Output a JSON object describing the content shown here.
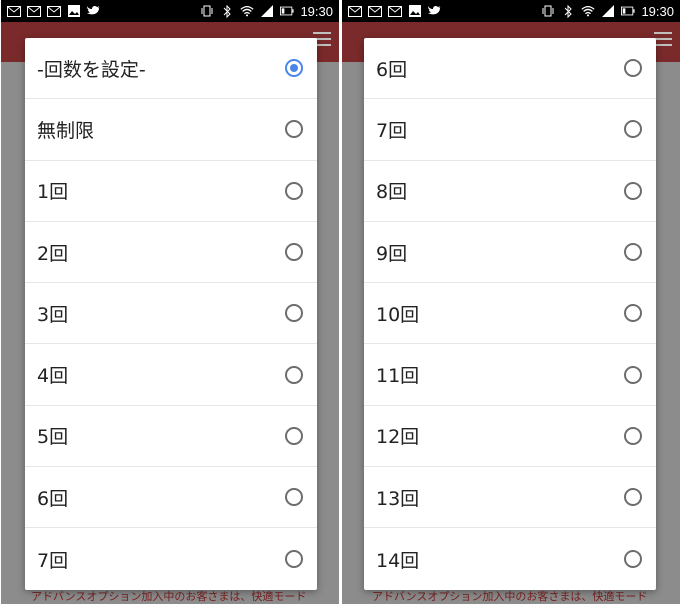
{
  "status_bar": {
    "time": "19:30",
    "icons": [
      "gmail-icon",
      "gmail-icon",
      "gmail-icon",
      "image-icon",
      "twitter-icon",
      "vibrate-icon",
      "bluetooth-icon",
      "wifi-icon",
      "signal-icon",
      "battery-icon"
    ]
  },
  "background": {
    "footer_text": "アドバンスオプション加入中のお客さまは、快適モード"
  },
  "left_dialog": {
    "options": [
      {
        "label": "-回数を設定-",
        "checked": true
      },
      {
        "label": "無制限",
        "checked": false
      },
      {
        "label": "1回",
        "checked": false
      },
      {
        "label": "2回",
        "checked": false
      },
      {
        "label": "3回",
        "checked": false
      },
      {
        "label": "4回",
        "checked": false
      },
      {
        "label": "5回",
        "checked": false
      },
      {
        "label": "6回",
        "checked": false
      },
      {
        "label": "7回",
        "checked": false
      }
    ]
  },
  "right_dialog": {
    "options": [
      {
        "label": "6回",
        "checked": false
      },
      {
        "label": "7回",
        "checked": false
      },
      {
        "label": "8回",
        "checked": false
      },
      {
        "label": "9回",
        "checked": false
      },
      {
        "label": "10回",
        "checked": false
      },
      {
        "label": "11回",
        "checked": false
      },
      {
        "label": "12回",
        "checked": false
      },
      {
        "label": "13回",
        "checked": false
      },
      {
        "label": "14回",
        "checked": false
      }
    ]
  },
  "colors": {
    "accent": "#4a86e8",
    "header": "#7a2a2a"
  }
}
